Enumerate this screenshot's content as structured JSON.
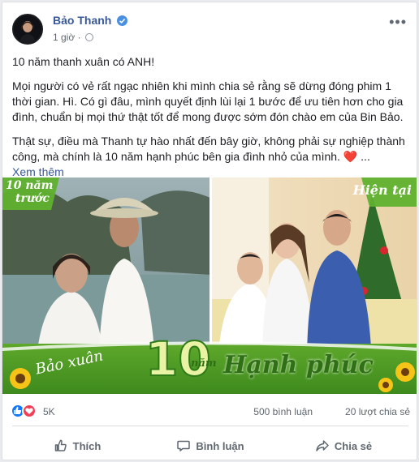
{
  "post": {
    "author": "Bảo Thanh",
    "time": "1 giờ",
    "paragraphs": [
      "10 năm thanh xuân có ANH!",
      "Mọi người có vẻ rất ngạc nhiên khi mình chia sẻ rằng sẽ dừng đóng phim 1 thời gian. Hì. Có gì đâu, mình quyết định lùi lại 1 bước để ưu tiên hơn cho gia đình, chuẩn bị mọi thứ thật tốt để mong được sớm đón chào em của Bin Bảo.",
      "Thật sự, điều mà Thanh tự hào nhất đến bây giờ, không phải sự nghiệp thành công, mà chính là 10 năm hạnh phúc bên gia đình nhỏ của mình."
    ],
    "heart": "❤️",
    "ellipsis": "...",
    "see_more": "Xem thêm"
  },
  "photo": {
    "badge_left_top": "10 năm",
    "badge_left_bottom": "trước",
    "badge_right": "Hiện tại",
    "banner_script": "Bảo xuân",
    "banner_number": "10",
    "banner_word": "năm",
    "banner_phrase": "Hạnh phúc"
  },
  "stats": {
    "reactions": "5K",
    "comments": "500 bình luận",
    "shares": "20 lượt chia sẻ"
  },
  "actions": {
    "like": "Thích",
    "comment": "Bình luận",
    "share": "Chia sẻ"
  }
}
